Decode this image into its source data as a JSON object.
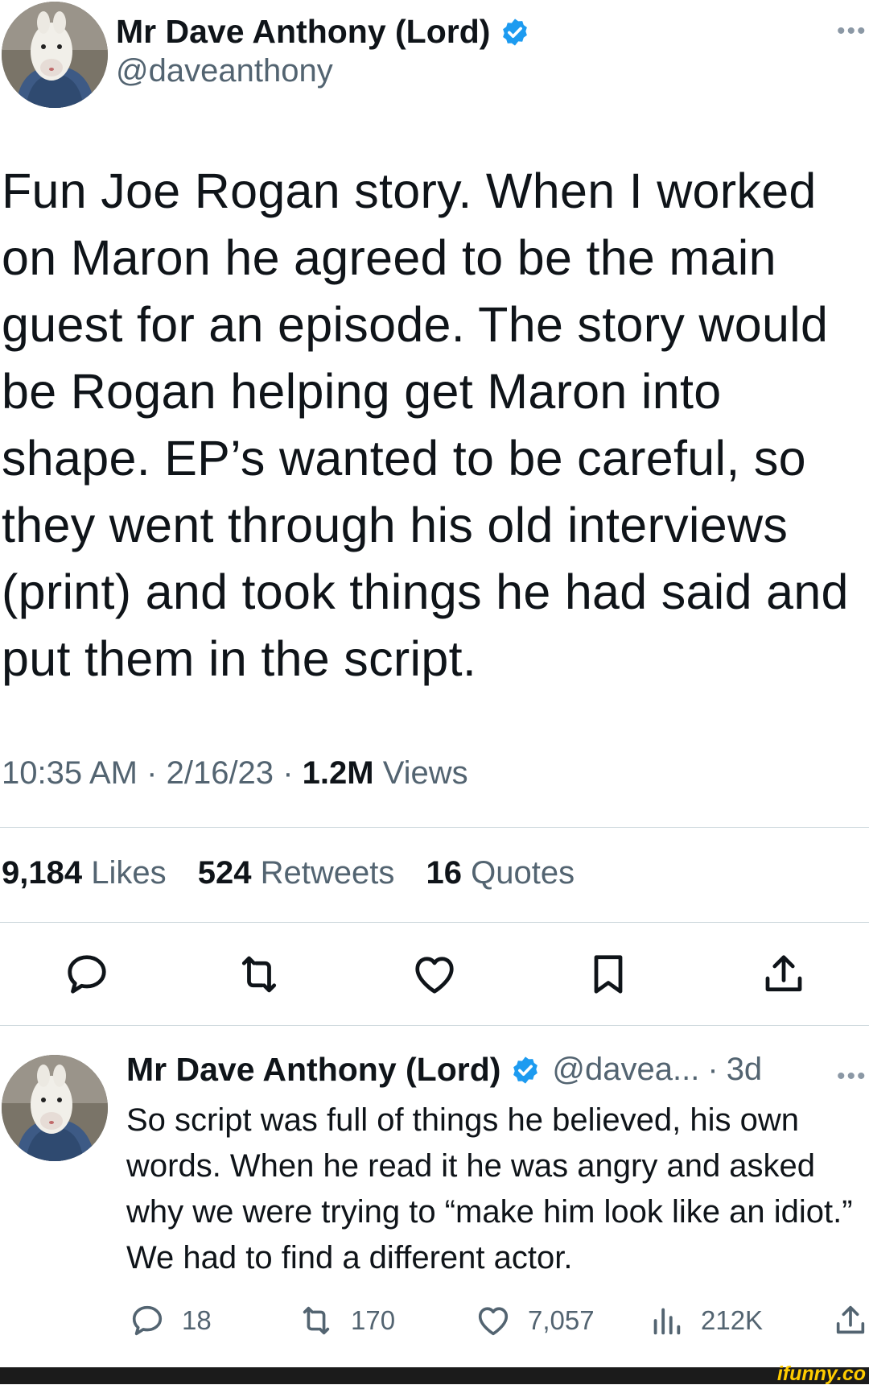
{
  "tweet": {
    "author_name": "Mr Dave Anthony (Lord)",
    "handle": "@daveanthony",
    "more_label": "•••",
    "text": "Fun Joe Rogan story. When I worked on Maron he agreed to be the main guest for an episode. The story would be Rogan helping get Maron into shape. EP’s wanted to be careful, so they went through his old interviews (print) and took things he had said and put them in the script.",
    "time": "10:35 AM",
    "date": "2/16/23",
    "separator": "·",
    "views_count": "1.2M",
    "views_label": "Views",
    "likes_count": "9,184",
    "likes_label": "Likes",
    "retweets_count": "524",
    "retweets_label": "Retweets",
    "quotes_count": "16",
    "quotes_label": "Quotes"
  },
  "reply": {
    "author_name": "Mr Dave Anthony (Lord)",
    "handle": "@davea...",
    "separator": "·",
    "age": "3d",
    "more_label": "•••",
    "text": "So script was full of things he believed, his own words. When he read it he was angry and asked why we were trying to “make him look like an idiot.” We had to find a different actor.",
    "reply_count": "18",
    "retweet_count": "170",
    "like_count": "7,057",
    "view_count": "212K"
  },
  "icons": {
    "verified": "verified-badge-icon",
    "reply": "speech-bubble-icon",
    "retweet": "retweet-arrows-icon",
    "like": "heart-icon",
    "bookmark": "bookmark-icon",
    "share": "share-upload-icon",
    "views": "bar-chart-icon"
  },
  "colors": {
    "verified_blue": "#1d9bf0",
    "text": "#0f1419",
    "secondary_text": "#536471",
    "divider": "#cfd9de"
  },
  "watermark": "ifunny.co"
}
